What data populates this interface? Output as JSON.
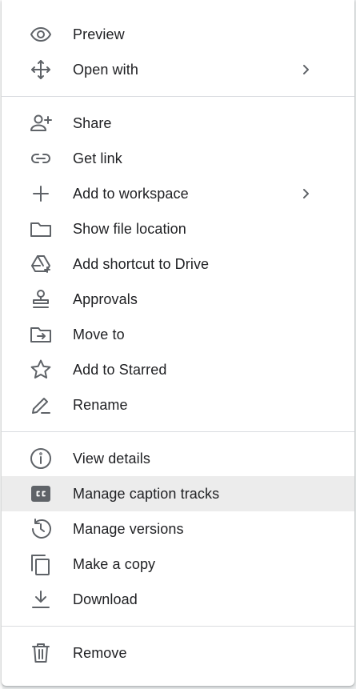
{
  "menu": {
    "groups": [
      [
        {
          "label": "Preview",
          "icon": "eye-icon",
          "submenu": false
        },
        {
          "label": "Open with",
          "icon": "move-arrows-icon",
          "submenu": true
        }
      ],
      [
        {
          "label": "Share",
          "icon": "person-add-icon",
          "submenu": false
        },
        {
          "label": "Get link",
          "icon": "link-icon",
          "submenu": false
        },
        {
          "label": "Add to workspace",
          "icon": "plus-icon",
          "submenu": true
        },
        {
          "label": "Show file location",
          "icon": "folder-icon",
          "submenu": false
        },
        {
          "label": "Add shortcut to Drive",
          "icon": "drive-shortcut-icon",
          "submenu": false
        },
        {
          "label": "Approvals",
          "icon": "stamp-icon",
          "submenu": false
        },
        {
          "label": "Move to",
          "icon": "folder-move-icon",
          "submenu": false
        },
        {
          "label": "Add to Starred",
          "icon": "star-icon",
          "submenu": false
        },
        {
          "label": "Rename",
          "icon": "pencil-icon",
          "submenu": false
        }
      ],
      [
        {
          "label": "View details",
          "icon": "info-icon",
          "submenu": false
        },
        {
          "label": "Manage caption tracks",
          "icon": "closed-caption-icon",
          "submenu": false,
          "highlighted": true
        },
        {
          "label": "Manage versions",
          "icon": "history-icon",
          "submenu": false
        },
        {
          "label": "Make a copy",
          "icon": "copy-icon",
          "submenu": false
        },
        {
          "label": "Download",
          "icon": "download-icon",
          "submenu": false
        }
      ],
      [
        {
          "label": "Remove",
          "icon": "trash-icon",
          "submenu": false
        }
      ]
    ]
  },
  "colors": {
    "icon": "#5f6368",
    "text": "#202124",
    "highlight": "#ececec",
    "divider": "#dadce0"
  }
}
